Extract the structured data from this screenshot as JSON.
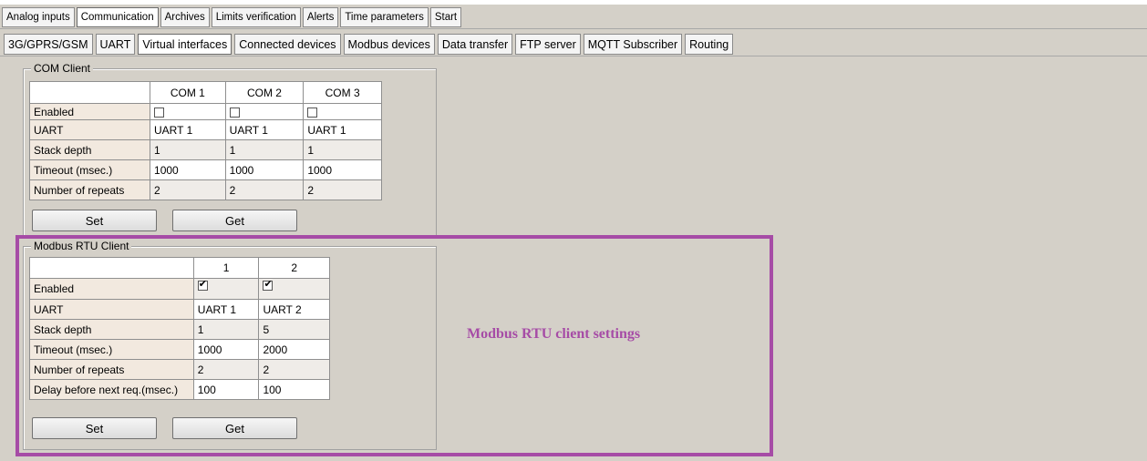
{
  "main_tabs": [
    {
      "label": "Analog inputs",
      "active": false
    },
    {
      "label": "Communication",
      "active": true
    },
    {
      "label": "Archives",
      "active": false
    },
    {
      "label": "Limits verification",
      "active": false
    },
    {
      "label": "Alerts",
      "active": false
    },
    {
      "label": "Time parameters",
      "active": false
    },
    {
      "label": "Start",
      "active": false
    }
  ],
  "sub_tabs": [
    {
      "label": "3G/GPRS/GSM",
      "active": false
    },
    {
      "label": "UART",
      "active": false
    },
    {
      "label": "Virtual interfaces",
      "active": true
    },
    {
      "label": "Connected devices",
      "active": false
    },
    {
      "label": "Modbus devices",
      "active": false
    },
    {
      "label": "Data transfer",
      "active": false
    },
    {
      "label": "FTP server",
      "active": false
    },
    {
      "label": "MQTT Subscriber",
      "active": false
    },
    {
      "label": "Routing",
      "active": false
    }
  ],
  "com_client": {
    "title": "COM Client",
    "columns": [
      "COM 1",
      "COM 2",
      "COM 3"
    ],
    "rows": [
      {
        "label": "Enabled",
        "type": "checkbox",
        "values": [
          false,
          false,
          false
        ]
      },
      {
        "label": "UART",
        "values": [
          "UART 1",
          "UART 1",
          "UART 1"
        ]
      },
      {
        "label": "Stack depth",
        "values": [
          "1",
          "1",
          "1"
        ]
      },
      {
        "label": "Timeout (msec.)",
        "values": [
          "1000",
          "1000",
          "1000"
        ]
      },
      {
        "label": "Number of repeats",
        "values": [
          "2",
          "2",
          "2"
        ]
      }
    ],
    "set_label": "Set",
    "get_label": "Get"
  },
  "modbus_rtu_client": {
    "title": "Modbus RTU Client",
    "columns": [
      "1",
      "2"
    ],
    "rows": [
      {
        "label": "Enabled",
        "type": "checkbox",
        "values": [
          true,
          true
        ]
      },
      {
        "label": "UART",
        "values": [
          "UART 1",
          "UART 2"
        ]
      },
      {
        "label": "Stack depth",
        "values": [
          "1",
          "5"
        ]
      },
      {
        "label": "Timeout (msec.)",
        "values": [
          "1000",
          "2000"
        ]
      },
      {
        "label": "Number of repeats",
        "values": [
          "2",
          "2"
        ]
      },
      {
        "label": "Delay before next req.(msec.)",
        "values": [
          "100",
          "100"
        ]
      }
    ],
    "set_label": "Set",
    "get_label": "Get"
  },
  "annotation": {
    "text": "Modbus RTU client settings",
    "color": "#a64ca6"
  }
}
